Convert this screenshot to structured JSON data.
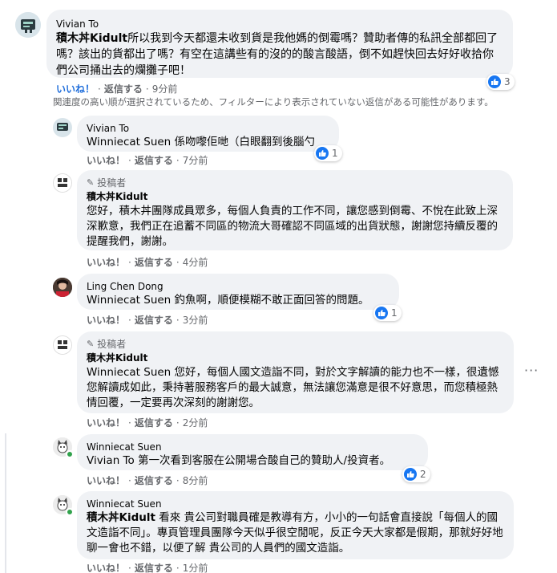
{
  "comments": [
    {
      "author": "Vivian To",
      "mention": "積木丼Kidult",
      "text": "所以我到今天都還未收到貨是我他媽的倒霉嗎？贊助者傳的私訊全部都回了嗎？該出的貨都出了嗎？有空在這講些有的沒的的酸言酸語，倒不如趕快回去好好收拾你們公司捅出去的爛攤子吧！",
      "like": "いいね！",
      "reply": "返信する",
      "time": "9分前",
      "reactions": "3"
    },
    {
      "author": "Vivian To",
      "mention": "Winniecat Suen",
      "text": " 係吻嚟佢哋（白眼翻到後腦勺",
      "like": "いいね！",
      "reply": "返信する",
      "time": "7分前",
      "reactions": "1"
    },
    {
      "badge": "投稿者",
      "author": "積木丼Kidult",
      "text": "您好，積木丼團隊成員眾多，每個人負責的工作不同，讓您感到倒霉、不悅在此致上深深歉意，我們正在追蓄不同區的物流大哥確認不同區域的出貨狀態，謝謝您持續反覆的提醒我們，謝謝。",
      "like": "いいね！",
      "reply": "返信する",
      "time": "4分前"
    },
    {
      "author": "Ling Chen Dong",
      "mention": "Winniecat Suen",
      "text": " 釣魚啊，順便模糊不敢正面回答的問題。",
      "like": "いいね！",
      "reply": "返信する",
      "time": "3分前",
      "reactions": "1"
    },
    {
      "badge": "投稿者",
      "author": "積木丼Kidult",
      "text": "Winniecat Suen 您好，每個人國文造詣不同，對於文字解讀的能力也不一樣，很遺憾您解讀成如此，秉持著服務客戶的最大誠意，無法讓您滿意是很不好意思，而您積極熱情回覆，一定要再次深刻的謝謝您。",
      "like": "いいね！",
      "reply": "返信する",
      "time": "2分前"
    },
    {
      "author": "Winniecat Suen",
      "mention": "Vivian To",
      "text": " 第一次看到客服在公開場合酸自己的贊助人/投資者。",
      "like": "いいね！",
      "reply": "返信する",
      "time": "8分前",
      "reactions": "2"
    },
    {
      "author": "Winniecat Suen",
      "mention": "積木丼Kidult",
      "text": " 看來 貴公司對職員確是教導有方，小小的一句話會直接說「每個人的國文造詣不同」。專頁管理員團隊今天似乎很空閒呢，反正今天大家都是假期，那就好好地聊一會也不錯，以便了解 貴公司的人員們的國文造詣。",
      "like": "いいね！",
      "reply": "返信する",
      "time": "1分前"
    }
  ],
  "filter_notice": "関連度の高い順が選択されているため、フィルターにより表示されていない返信がある可能性があります。",
  "icons": {
    "like": "thumbs-up-icon",
    "more": "more-options-icon",
    "badge": "pencil-icon"
  },
  "colors": {
    "bubble": "#f0f2f5",
    "like_blue": "#1877f2",
    "meta": "#65676b",
    "active_like": "#216fdb"
  }
}
